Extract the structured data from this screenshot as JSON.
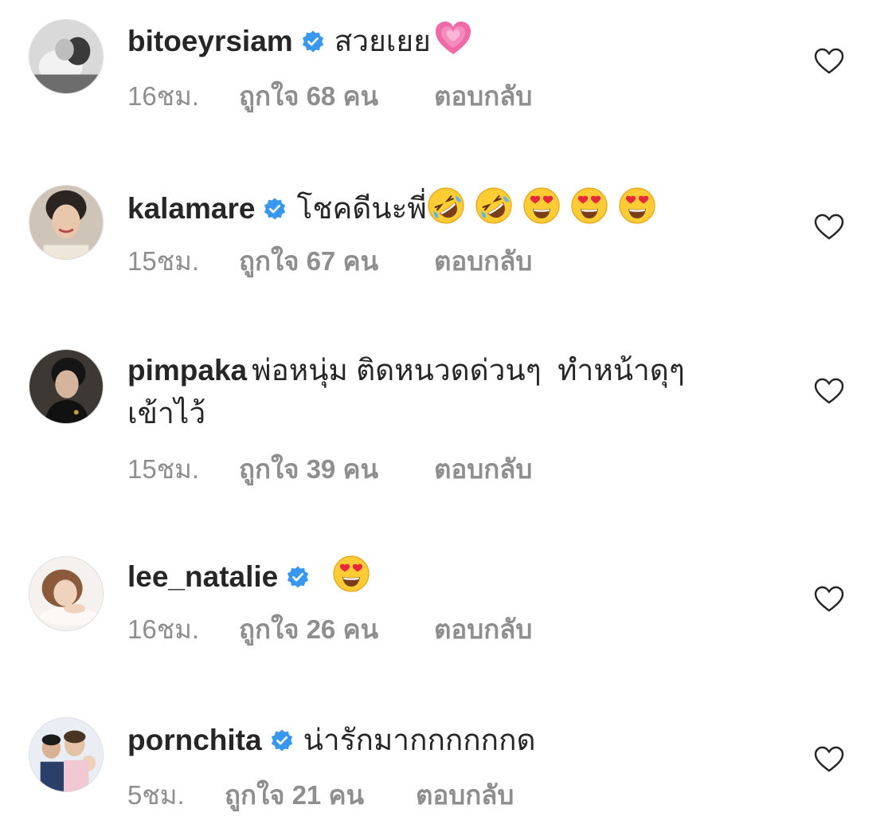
{
  "comments": [
    {
      "username": "bitoeyrsiam",
      "verified": true,
      "text": "สวยเยย",
      "emojis": [
        "growing-heart"
      ],
      "time": "16ชม.",
      "likes": "ถูกใจ 68 คน",
      "reply": "ตอบกลับ"
    },
    {
      "username": "kalamare",
      "verified": true,
      "text": "โชคดีนะพี่",
      "emojis": [
        "rofl",
        "rofl",
        "heart-eyes",
        "heart-eyes",
        "heart-eyes"
      ],
      "time": "15ชม.",
      "likes": "ถูกใจ 67 คน",
      "reply": "ตอบกลับ"
    },
    {
      "username": "pimpaka",
      "verified": false,
      "text": "พ่อหนุ่ม ติดหนวดด่วนๆ  ทำหน้าดุๆ",
      "text_line2": "เข้าไว้",
      "emojis": [],
      "time": "15ชม.",
      "likes": "ถูกใจ 39 คน",
      "reply": "ตอบกลับ"
    },
    {
      "username": "lee_natalie",
      "verified": true,
      "text": "",
      "emojis": [
        "heart-eyes"
      ],
      "time": "16ชม.",
      "likes": "ถูกใจ 26 คน",
      "reply": "ตอบกลับ"
    },
    {
      "username": "pornchita",
      "verified": true,
      "text": "น่ารักมากกกกกกด",
      "emojis": [],
      "time": "5ชม.",
      "likes": "ถูกใจ 21 คน",
      "reply": "ตอบกลับ"
    }
  ],
  "colors": {
    "verified_blue": "#3897f0",
    "meta_gray": "#8e8e8e",
    "text": "#262626"
  },
  "icons": {
    "verified": "verified-badge-icon",
    "like": "heart-outline-icon"
  }
}
